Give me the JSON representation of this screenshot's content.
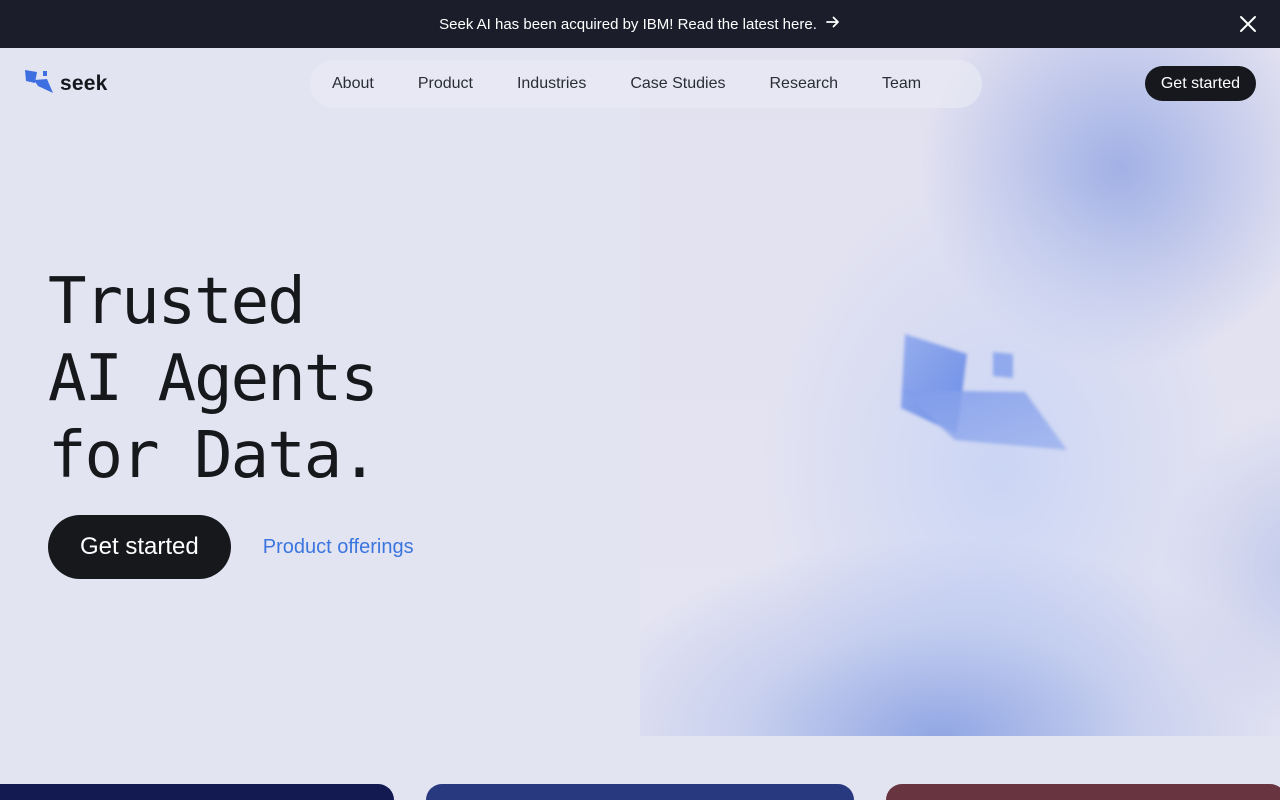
{
  "announcement": {
    "text": "Seek AI has been acquired by IBM! Read the latest here.",
    "arrow_icon": "arrow-right-icon",
    "close_icon": "close-icon"
  },
  "header": {
    "logo_text": "seek",
    "nav": [
      {
        "label": "About"
      },
      {
        "label": "Product"
      },
      {
        "label": "Industries"
      },
      {
        "label": "Case Studies"
      },
      {
        "label": "Research"
      },
      {
        "label": "Team"
      }
    ],
    "cta_label": "Get started"
  },
  "hero": {
    "title_lines": [
      "Trusted",
      "AI Agents",
      "for Data."
    ],
    "primary_cta": "Get started",
    "secondary_link": "Product offerings"
  },
  "colors": {
    "announcement_bg": "#1b1d2a",
    "page_bg": "#e3e4f2",
    "brand_blue": "#3b76e0",
    "dark_button": "#16181d",
    "card_navy": "#131a52",
    "card_blue": "#283980",
    "card_maroon": "#673440"
  }
}
